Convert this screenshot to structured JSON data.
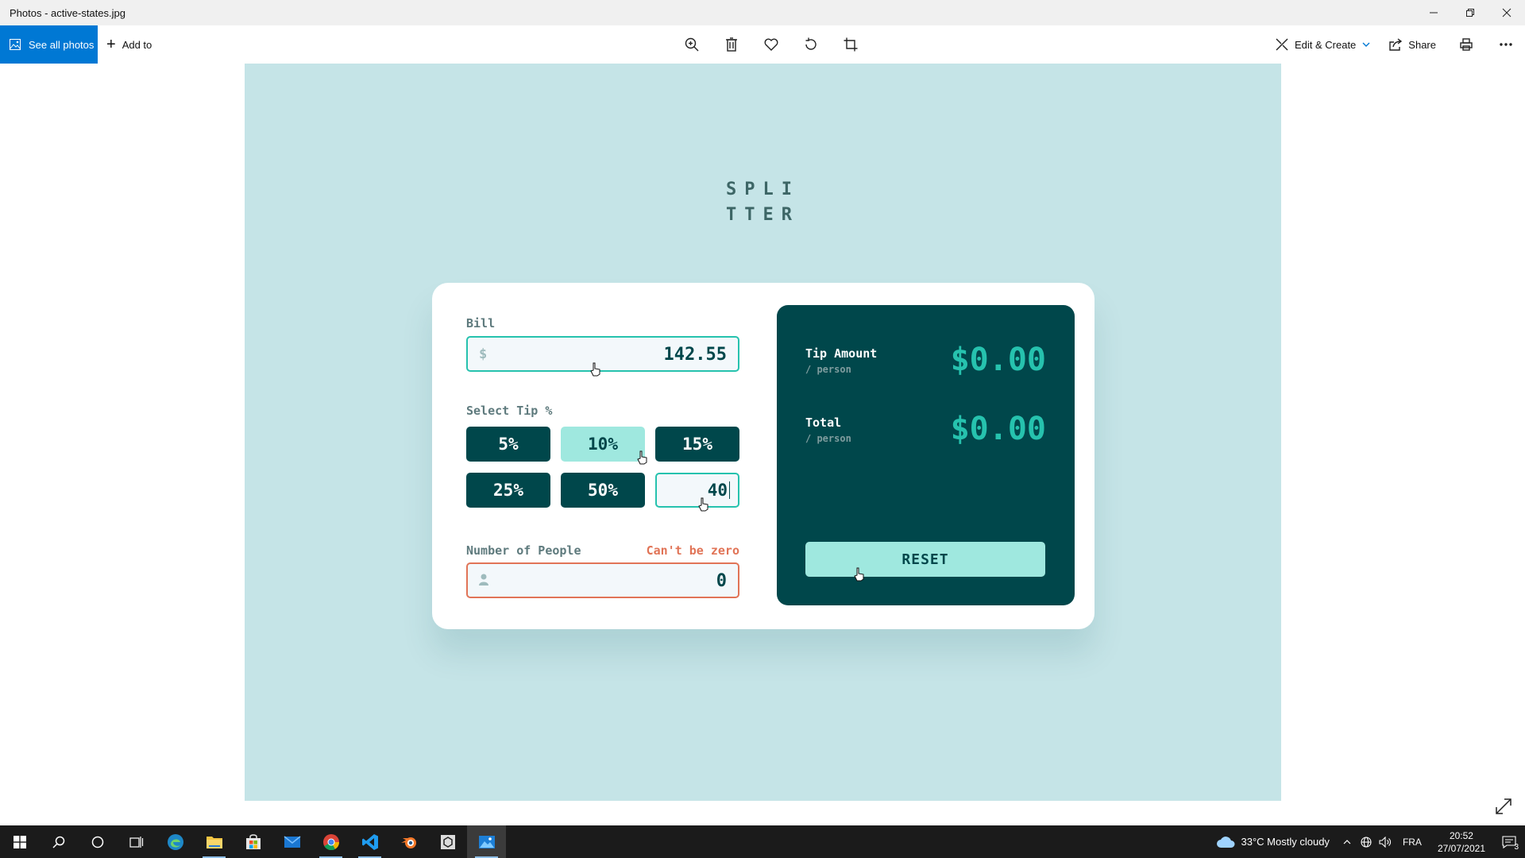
{
  "window": {
    "title": "Photos - active-states.jpg"
  },
  "toolbar": {
    "see_all_label": "See all photos",
    "add_to_label": "Add to",
    "edit_create_label": "Edit & Create",
    "share_label": "Share"
  },
  "app": {
    "logo_line1": "SPLI",
    "logo_line2": "TTER",
    "bill_label": "Bill",
    "bill_currency": "$",
    "bill_value": "142.55",
    "tip_label": "Select Tip %",
    "tips": [
      "5%",
      "10%",
      "15%",
      "25%",
      "50%"
    ],
    "custom_tip_value": "40",
    "people_label": "Number of People",
    "people_error": "Can't be zero",
    "people_value": "0",
    "tip_amount_label": "Tip Amount",
    "tip_amount_sub": "/ person",
    "tip_amount_value": "$0.00",
    "total_label": "Total",
    "total_sub": "/ person",
    "total_value": "$0.00",
    "reset_label": "RESET"
  },
  "taskbar": {
    "weather": "33°C  Mostly cloudy",
    "language": "FRA",
    "time": "20:52",
    "date": "27/07/2021",
    "notification_count": "3"
  },
  "colors": {
    "accent": "#0078d4",
    "background": "#c5e4e7",
    "dark_cyan": "#00474b",
    "strong_cyan": "#26c2ae",
    "light_cyan": "#9fe8df",
    "error": "#e17457"
  }
}
